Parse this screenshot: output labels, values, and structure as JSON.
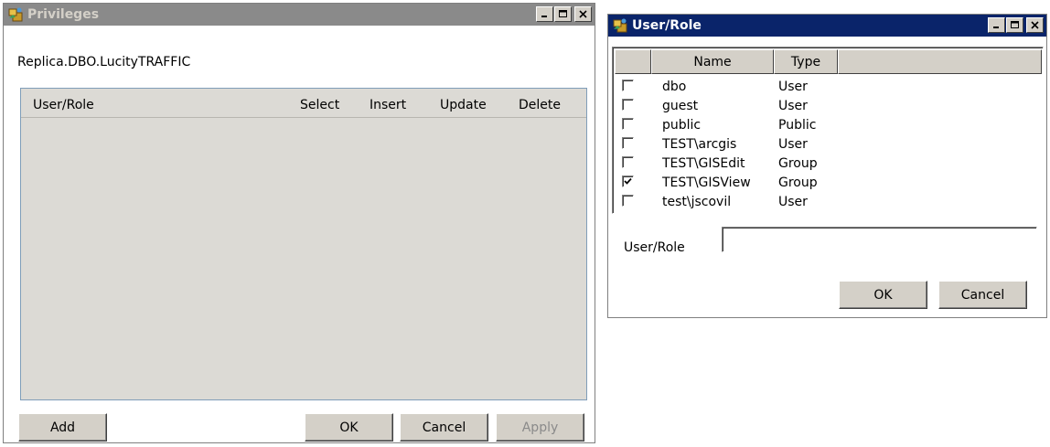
{
  "privileges_window": {
    "title": "Privileges",
    "object_name": "Replica.DBO.LucityTRAFFIC",
    "columns": [
      "User/Role",
      "Select",
      "Insert",
      "Update",
      "Delete"
    ],
    "buttons": {
      "add": "Add",
      "ok": "OK",
      "cancel": "Cancel",
      "apply": "Apply"
    }
  },
  "user_role_window": {
    "title": "User/Role",
    "columns": [
      "Name",
      "Type"
    ],
    "rows": [
      {
        "name": "dbo",
        "type": "User",
        "checked": false
      },
      {
        "name": "guest",
        "type": "User",
        "checked": false
      },
      {
        "name": "public",
        "type": "Public",
        "checked": false
      },
      {
        "name": "TEST\\arcgis",
        "type": "User",
        "checked": false
      },
      {
        "name": "TEST\\GISEdit",
        "type": "Group",
        "checked": false
      },
      {
        "name": "TEST\\GISView",
        "type": "Group",
        "checked": true
      },
      {
        "name": "test\\jscovil",
        "type": "User",
        "checked": false
      }
    ],
    "field_label": "User/Role",
    "field_value": "",
    "buttons": {
      "ok": "OK",
      "cancel": "Cancel"
    }
  },
  "colors": {
    "inactive_title": "#8a8a8a",
    "active_title": "#0a246a",
    "button_face": "#d4d0c8",
    "grid_bg": "#dcdad5",
    "grid_border": "#7f9db9"
  }
}
